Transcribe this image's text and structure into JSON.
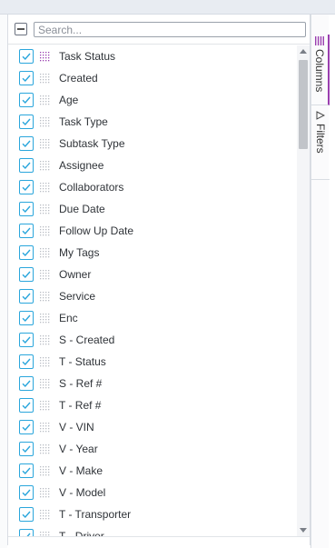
{
  "search": {
    "placeholder": "Search..."
  },
  "columns": [
    {
      "label": "Task Status",
      "checked": true
    },
    {
      "label": "Created",
      "checked": true
    },
    {
      "label": "Age",
      "checked": true
    },
    {
      "label": "Task Type",
      "checked": true
    },
    {
      "label": "Subtask Type",
      "checked": true
    },
    {
      "label": "Assignee",
      "checked": true
    },
    {
      "label": "Collaborators",
      "checked": true
    },
    {
      "label": "Due Date",
      "checked": true
    },
    {
      "label": "Follow Up Date",
      "checked": true
    },
    {
      "label": "My Tags",
      "checked": true
    },
    {
      "label": "Owner",
      "checked": true
    },
    {
      "label": "Service",
      "checked": true
    },
    {
      "label": "Enc",
      "checked": true
    },
    {
      "label": "S - Created",
      "checked": true
    },
    {
      "label": "T - Status",
      "checked": true
    },
    {
      "label": "S - Ref #",
      "checked": true
    },
    {
      "label": "T - Ref #",
      "checked": true
    },
    {
      "label": "V - VIN",
      "checked": true
    },
    {
      "label": "V - Year",
      "checked": true
    },
    {
      "label": "V - Make",
      "checked": true
    },
    {
      "label": "V - Model",
      "checked": true
    },
    {
      "label": "T - Transporter",
      "checked": true
    },
    {
      "label": "T - Driver",
      "checked": true
    }
  ],
  "side_tabs": [
    {
      "label": "Columns",
      "icon": "columns-icon",
      "active": true
    },
    {
      "label": "Filters",
      "icon": "filter-icon",
      "active": false
    }
  ],
  "colors": {
    "checkbox": "#2aa6dc",
    "grip_active": "#9b3fb0",
    "grip": "#b9bdc4",
    "active_tab": "#9b3fb0"
  }
}
